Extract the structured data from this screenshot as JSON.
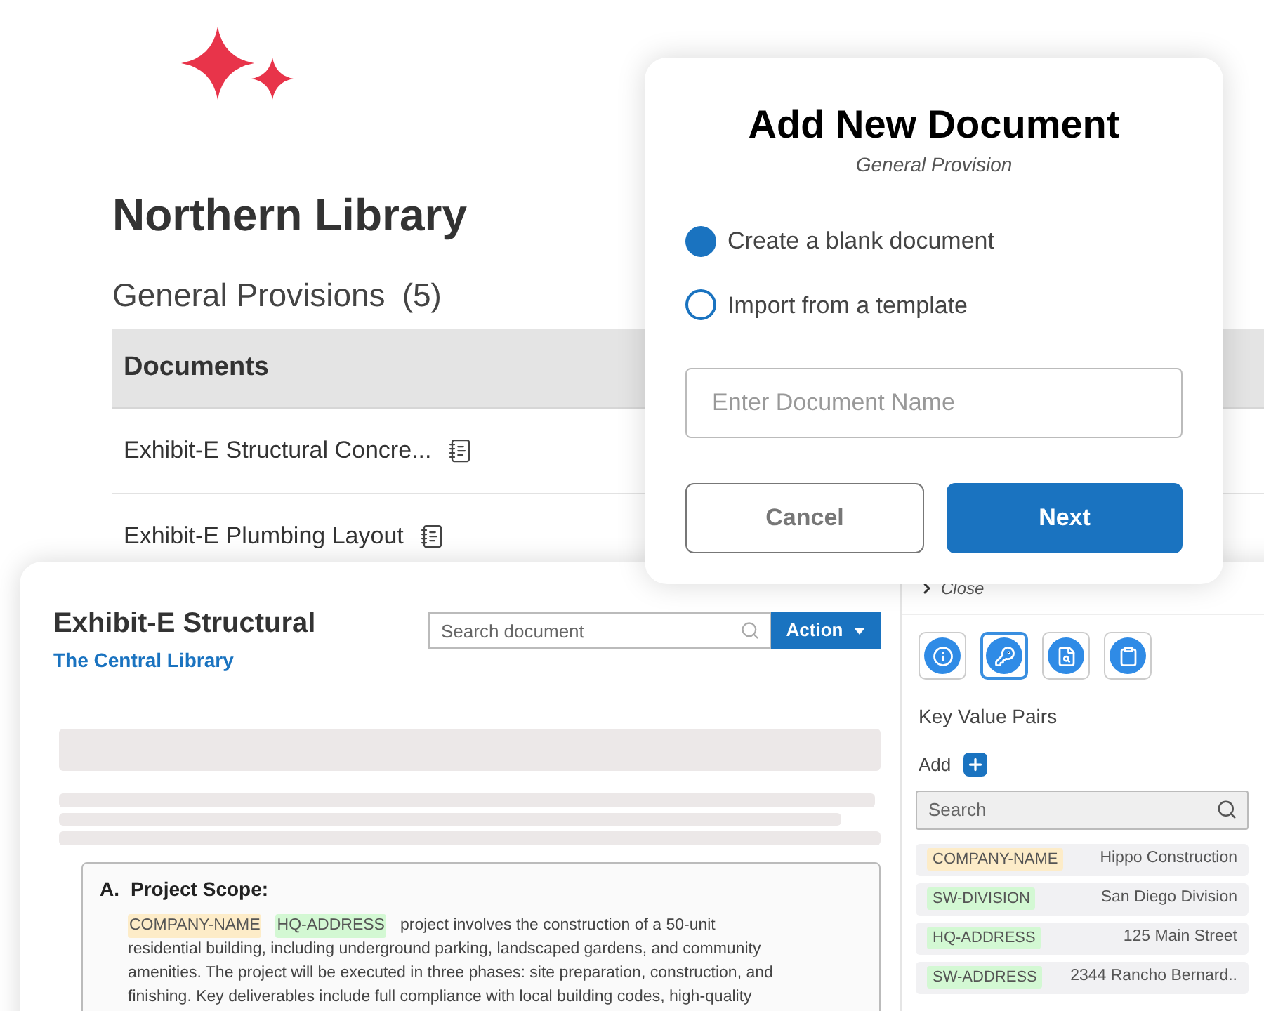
{
  "library": {
    "title": "Northern Library",
    "section": "General Provisions",
    "count": "(5)"
  },
  "documents_table": {
    "columns": [
      "Documents"
    ],
    "rows": [
      {
        "name": "Exhibit-E Structural Concre..."
      },
      {
        "name": "Exhibit-E Plumbing Layout"
      }
    ]
  },
  "document_view": {
    "title": "Exhibit-E Structural",
    "library_link": "The Central Library",
    "search": {
      "placeholder": "Search document"
    },
    "action_button": "Action",
    "section": {
      "marker": "A.",
      "heading": "Project Scope:",
      "tags": [
        {
          "label": "COMPANY-NAME",
          "color": "#fdecc8"
        },
        {
          "label": "HQ-ADDRESS",
          "color": "#d3f8d3"
        }
      ],
      "first_line": "project involves the construction of a 50-unit",
      "text": "residential  building, including underground parking,  landscaped gardens, and community amenities. The project will be executed in three phases: site preparation, construction, and finishing. Key deliverables include full compliance with local building codes, high-quality"
    }
  },
  "side_panel": {
    "close": "Close",
    "tools": [
      {
        "kind": "info",
        "selected": false
      },
      {
        "kind": "key",
        "selected": true
      },
      {
        "kind": "document",
        "selected": false
      },
      {
        "kind": "clipboard",
        "selected": false
      }
    ],
    "heading": "Key Value Pairs",
    "add_label": "Add",
    "search": {
      "placeholder": "Search"
    },
    "pairs": [
      {
        "key": "COMPANY-NAME",
        "color": "#fdecc8",
        "value": "Hippo Construction"
      },
      {
        "key": "SW-DIVISION",
        "color": "#d3f8d3",
        "value": "San Diego Division"
      },
      {
        "key": "HQ-ADDRESS",
        "color": "#d3f8d3",
        "value": "125 Main Street"
      },
      {
        "key": "SW-ADDRESS",
        "color": "#d3f8d3",
        "value": "2344 Rancho Bernard.."
      }
    ]
  },
  "dialog": {
    "title": "Add New Document",
    "subtitle": "General Provision",
    "options": [
      {
        "label": "Create a blank document",
        "selected": true
      },
      {
        "label": "Import from a template",
        "selected": false
      }
    ],
    "name_field": {
      "placeholder": "Enter Document Name"
    },
    "buttons": [
      {
        "kind": "secondary",
        "label": "Cancel"
      },
      {
        "kind": "primary",
        "label": "Next"
      }
    ]
  }
}
